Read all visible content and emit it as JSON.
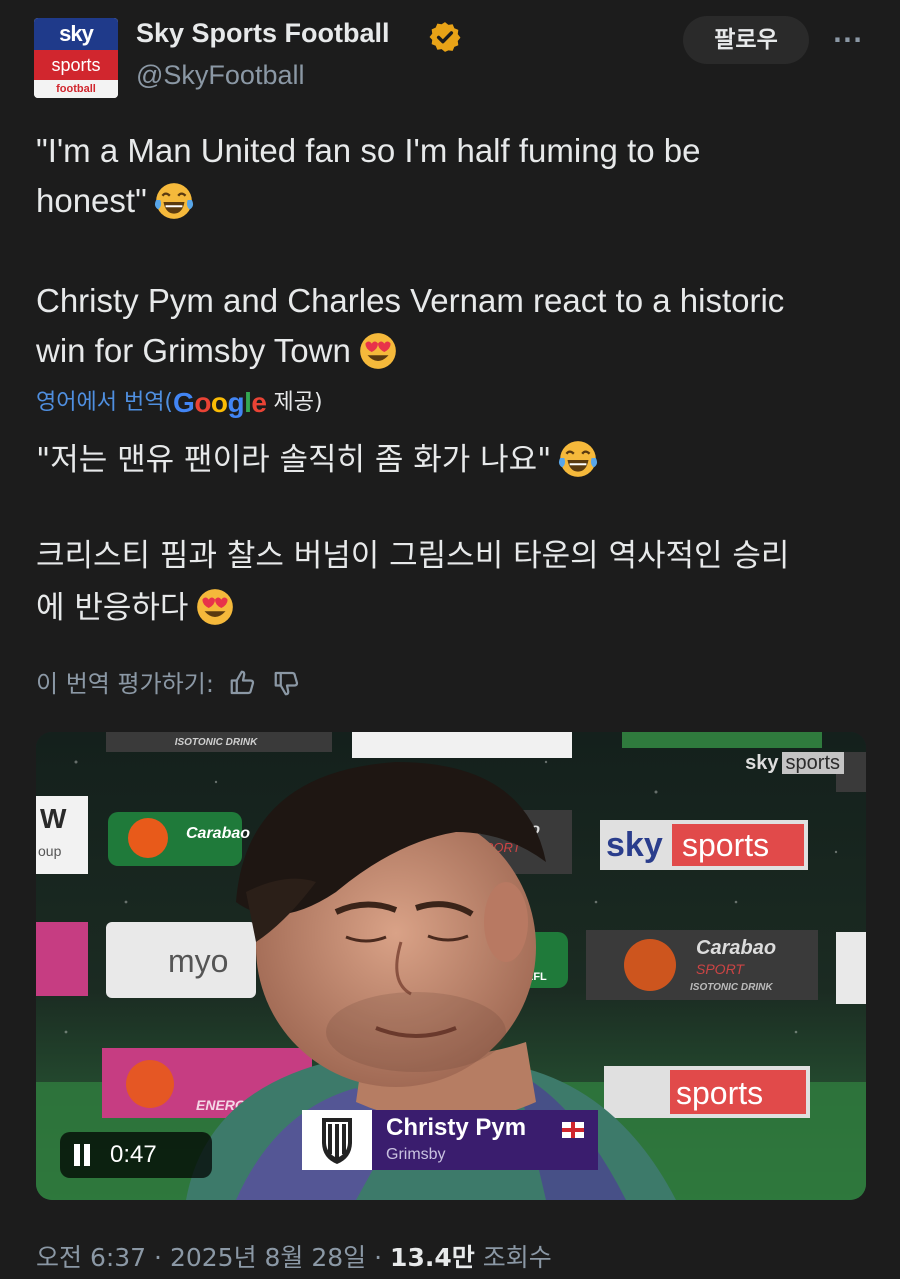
{
  "account": {
    "name": "Sky Sports Football",
    "handle": "@SkyFootball",
    "avatar_lines": [
      "sky",
      "sports",
      "football"
    ],
    "verified_color": "#e8a317"
  },
  "actions": {
    "follow_label": "팔로우",
    "more_label": "···"
  },
  "tweet": {
    "original_line1": "\"I'm a Man United fan so I'm half fuming to be",
    "original_line2": "honest\"",
    "original_line3": "Christy Pym and Charles Vernam react to a historic",
    "original_line4": "win for Grimsby Town",
    "translated_from": "영어에서 번역(",
    "translated_by": "Google",
    "translated_provided": " 제공)",
    "translation_line1": "\"저는 맨유 팬이라 솔직히 좀 화가 나요\"",
    "translation_line2": "크리스티 핌과 찰스 버넘이 그림스비 타운의 역사적인 승리",
    "translation_line3": "에 반응하다",
    "emojis": [
      "joy-emoji",
      "heart-eyes-emoji"
    ]
  },
  "rating": {
    "label": "이 번역 평가하기:"
  },
  "video": {
    "time": "0:47",
    "watermark_sky": "sky",
    "watermark_sports": "sports",
    "caption_name": "Christy Pym",
    "caption_club": "Grimsby",
    "board_texts": [
      "ISOTONIC DRINK",
      "Carabao",
      "SPORT",
      "ISOTONIC DRINK",
      "sky",
      "sports",
      "myo",
      "EFL",
      "ENERGY DRINK",
      "W",
      "oup"
    ]
  },
  "meta": {
    "time": "오전 6:37",
    "date": "2025년 8월 28일",
    "views_count": "13.4만",
    "views_label": "조회수",
    "separator": "·"
  },
  "colors": {
    "background": "#1c1c1c",
    "text": "#e7e9ea",
    "secondary": "#8b98a5",
    "link": "#4f8fe0",
    "sky_red": "#d1262e",
    "caption_purple": "#3a1d6e"
  }
}
